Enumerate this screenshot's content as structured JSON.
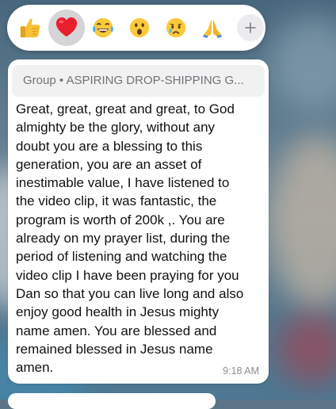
{
  "reactions": [
    {
      "icon": "thumbs-up-icon",
      "emoji": "👍",
      "selected": false
    },
    {
      "icon": "red-heart-icon",
      "emoji": "❤️",
      "selected": true
    },
    {
      "icon": "tears-of-joy-icon",
      "emoji": "😂",
      "selected": false
    },
    {
      "icon": "surprised-face-icon",
      "emoji": "😮",
      "selected": false
    },
    {
      "icon": "crying-face-icon",
      "emoji": "😢",
      "selected": false
    },
    {
      "icon": "folded-hands-icon",
      "emoji": "🙏",
      "selected": false
    }
  ],
  "add_reaction_icon": "plus-icon",
  "message": {
    "quote": "Group • ASPIRING DROP-SHIPPING G...",
    "lines": [
      "Great, great, great and great, to God",
      "almighty be the glory, without any",
      "doubt you are a blessing to this",
      "generation, you are an asset of",
      "inestimable value, I have listened to",
      "the video clip, it was fantastic, the",
      "program is worth of 200k ,. You are",
      "already on my prayer list, during the",
      "period of listening and watching the",
      "video clip I have been praying for you",
      "Dan so that you can live long and also",
      "enjoy good health in Jesus mighty",
      "name amen. You are blessed and",
      "remained blessed in Jesus name",
      "amen."
    ],
    "time": "9:18 AM"
  },
  "colors": {
    "bubble": "#ffffff",
    "selected_reaction_bg": "#d5d5d7",
    "quote_bg": "#f1f1f2",
    "timestamp": "#8a8d91"
  }
}
